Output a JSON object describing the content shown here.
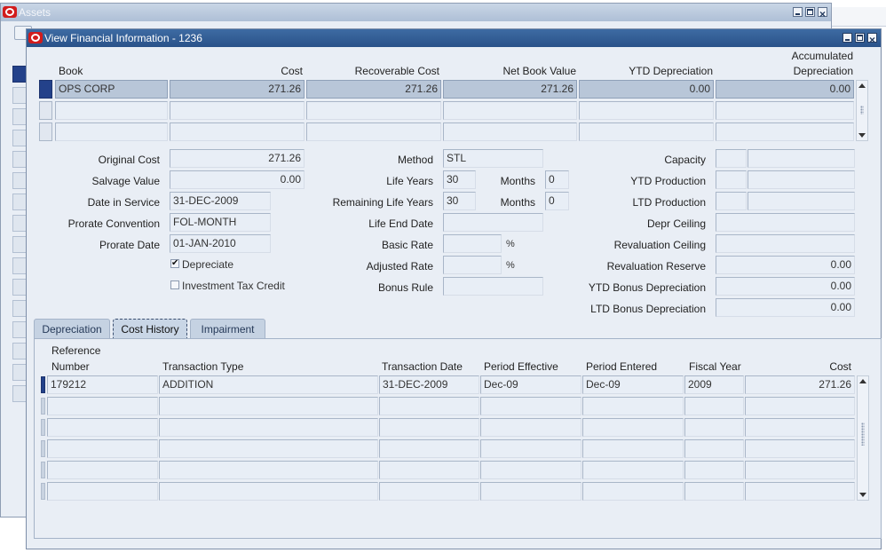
{
  "background_window": {
    "title": "Assets"
  },
  "window": {
    "title": "View Financial Information - 1236"
  },
  "books_table": {
    "headers": {
      "book": "Book",
      "cost": "Cost",
      "recoverable_cost": "Recoverable Cost",
      "net_book_value": "Net Book Value",
      "ytd_depreciation": "YTD Depreciation",
      "accumulated_line1": "Accumulated",
      "accumulated_line2": "Depreciation"
    },
    "rows": [
      {
        "book": "OPS CORP",
        "cost": "271.26",
        "recoverable_cost": "271.26",
        "net_book_value": "271.26",
        "ytd_depreciation": "0.00",
        "accumulated_depreciation": "0.00"
      },
      {
        "book": "",
        "cost": "",
        "recoverable_cost": "",
        "net_book_value": "",
        "ytd_depreciation": "",
        "accumulated_depreciation": ""
      },
      {
        "book": "",
        "cost": "",
        "recoverable_cost": "",
        "net_book_value": "",
        "ytd_depreciation": "",
        "accumulated_depreciation": ""
      }
    ]
  },
  "details": {
    "original_cost": {
      "label": "Original Cost",
      "value": "271.26"
    },
    "salvage_value": {
      "label": "Salvage Value",
      "value": "0.00"
    },
    "date_in_service": {
      "label": "Date in Service",
      "value": "31-DEC-2009"
    },
    "prorate_convention": {
      "label": "Prorate Convention",
      "value": "FOL-MONTH"
    },
    "prorate_date": {
      "label": "Prorate Date",
      "value": "01-JAN-2010"
    },
    "depreciate": {
      "label": "Depreciate",
      "checked": true,
      "mark": "✔"
    },
    "investment_tax_credit": {
      "label": "Investment Tax Credit",
      "checked": false
    },
    "method": {
      "label": "Method",
      "value": "STL"
    },
    "life_years": {
      "label": "Life Years",
      "value": "30"
    },
    "life_months": {
      "label": "Months",
      "value": "0"
    },
    "remaining_life_years": {
      "label": "Remaining Life Years",
      "value": "30"
    },
    "remaining_months": {
      "label": "Months",
      "value": "0"
    },
    "life_end_date": {
      "label": "Life End Date",
      "value": ""
    },
    "basic_rate": {
      "label": "Basic Rate",
      "value": "",
      "unit": "%"
    },
    "adjusted_rate": {
      "label": "Adjusted Rate",
      "value": "",
      "unit": "%"
    },
    "bonus_rule": {
      "label": "Bonus Rule",
      "value": ""
    },
    "capacity": {
      "label": "Capacity",
      "value": ""
    },
    "ytd_production": {
      "label": "YTD Production",
      "value": ""
    },
    "ltd_production": {
      "label": "LTD Production",
      "value": ""
    },
    "depr_ceiling": {
      "label": "Depr Ceiling",
      "value": ""
    },
    "revaluation_ceiling": {
      "label": "Revaluation Ceiling",
      "value": ""
    },
    "revaluation_reserve": {
      "label": "Revaluation Reserve",
      "value": "0.00"
    },
    "ytd_bonus_depreciation": {
      "label": "YTD Bonus Depreciation",
      "value": "0.00"
    },
    "ltd_bonus_depreciation": {
      "label": "LTD Bonus Depreciation",
      "value": "0.00"
    }
  },
  "tabs": [
    {
      "label": "Depreciation",
      "active": false
    },
    {
      "label": "Cost History",
      "active": true
    },
    {
      "label": "Impairment",
      "active": false
    }
  ],
  "cost_history": {
    "headers": {
      "reference_line1": "Reference",
      "reference_line2": "Number",
      "transaction_type": "Transaction Type",
      "transaction_date": "Transaction Date",
      "period_effective": "Period Effective",
      "period_entered": "Period Entered",
      "fiscal_year": "Fiscal Year",
      "cost": "Cost"
    },
    "rows": [
      {
        "reference": "179212",
        "transaction_type": "ADDITION",
        "transaction_date": "31-DEC-2009",
        "period_effective": "Dec-09",
        "period_entered": "Dec-09",
        "fiscal_year": "2009",
        "cost": "271.26"
      },
      {
        "reference": "",
        "transaction_type": "",
        "transaction_date": "",
        "period_effective": "",
        "period_entered": "",
        "fiscal_year": "",
        "cost": ""
      },
      {
        "reference": "",
        "transaction_type": "",
        "transaction_date": "",
        "period_effective": "",
        "period_entered": "",
        "fiscal_year": "",
        "cost": ""
      },
      {
        "reference": "",
        "transaction_type": "",
        "transaction_date": "",
        "period_effective": "",
        "period_entered": "",
        "fiscal_year": "",
        "cost": ""
      },
      {
        "reference": "",
        "transaction_type": "",
        "transaction_date": "",
        "period_effective": "",
        "period_entered": "",
        "fiscal_year": "",
        "cost": ""
      },
      {
        "reference": "",
        "transaction_type": "",
        "transaction_date": "",
        "period_effective": "",
        "period_entered": "",
        "fiscal_year": "",
        "cost": ""
      }
    ]
  },
  "colors": {
    "title_bar": "#2a5289",
    "window_bg": "#e9eef5",
    "field_bg": "#e8eef6",
    "selected_row": "#b8c6d8",
    "record_indicator": "#23418a",
    "logo_red": "#d21c1c"
  }
}
